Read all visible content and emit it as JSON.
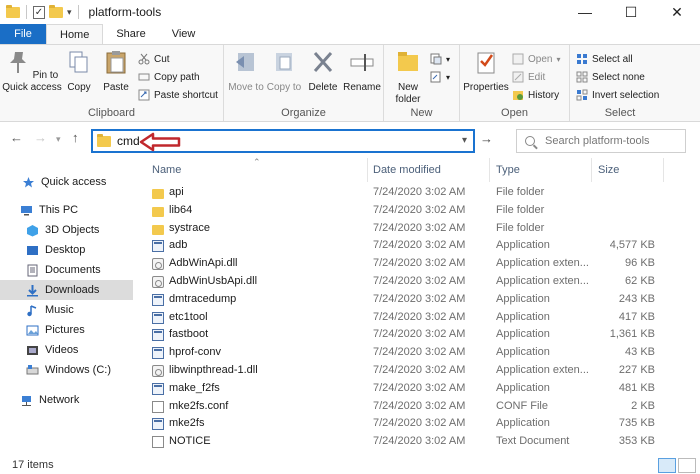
{
  "window": {
    "title": "platform-tools",
    "minimize": "—",
    "maximize": "☐",
    "close": "✕"
  },
  "tabs": [
    "File",
    "Home",
    "Share",
    "View"
  ],
  "ribbon": {
    "clipboard": {
      "label": "Clipboard",
      "pin": "Pin to Quick access",
      "copy": "Copy",
      "paste": "Paste",
      "cut": "Cut",
      "copy_path": "Copy path",
      "paste_shortcut": "Paste shortcut"
    },
    "organize": {
      "label": "Organize",
      "move_to": "Move to",
      "copy_to": "Copy to",
      "delete": "Delete",
      "rename": "Rename"
    },
    "new": {
      "label": "New",
      "new_folder": "New folder"
    },
    "open": {
      "label": "Open",
      "properties": "Properties",
      "open": "Open",
      "edit": "Edit",
      "history": "History"
    },
    "select": {
      "label": "Select",
      "select_all": "Select all",
      "select_none": "Select none",
      "invert": "Invert selection"
    }
  },
  "address": {
    "value": "cmd",
    "search_placeholder": "Search platform-tools"
  },
  "nav": [
    {
      "label": "Quick access",
      "icon": "star-icon",
      "selected": false
    },
    {
      "label": "This PC",
      "icon": "pc-icon",
      "selected": false
    },
    {
      "label": "3D Objects",
      "icon": "cube-icon",
      "selected": false
    },
    {
      "label": "Desktop",
      "icon": "desktop-icon",
      "selected": false
    },
    {
      "label": "Documents",
      "icon": "documents-icon",
      "selected": false
    },
    {
      "label": "Downloads",
      "icon": "download-icon",
      "selected": true
    },
    {
      "label": "Music",
      "icon": "music-icon",
      "selected": false
    },
    {
      "label": "Pictures",
      "icon": "pictures-icon",
      "selected": false
    },
    {
      "label": "Videos",
      "icon": "videos-icon",
      "selected": false
    },
    {
      "label": "Windows (C:)",
      "icon": "drive-icon",
      "selected": false
    },
    {
      "label": "Network",
      "icon": "network-icon",
      "selected": false
    }
  ],
  "columns": {
    "name": "Name",
    "date": "Date modified",
    "type": "Type",
    "size": "Size"
  },
  "files": [
    {
      "name": "api",
      "date": "7/24/2020 3:02 AM",
      "type": "File folder",
      "size": "",
      "icon": "folder"
    },
    {
      "name": "lib64",
      "date": "7/24/2020 3:02 AM",
      "type": "File folder",
      "size": "",
      "icon": "folder"
    },
    {
      "name": "systrace",
      "date": "7/24/2020 3:02 AM",
      "type": "File folder",
      "size": "",
      "icon": "folder"
    },
    {
      "name": "adb",
      "date": "7/24/2020 3:02 AM",
      "type": "Application",
      "size": "4,577 KB",
      "icon": "app"
    },
    {
      "name": "AdbWinApi.dll",
      "date": "7/24/2020 3:02 AM",
      "type": "Application exten...",
      "size": "96 KB",
      "icon": "dll"
    },
    {
      "name": "AdbWinUsbApi.dll",
      "date": "7/24/2020 3:02 AM",
      "type": "Application exten...",
      "size": "62 KB",
      "icon": "dll"
    },
    {
      "name": "dmtracedump",
      "date": "7/24/2020 3:02 AM",
      "type": "Application",
      "size": "243 KB",
      "icon": "app"
    },
    {
      "name": "etc1tool",
      "date": "7/24/2020 3:02 AM",
      "type": "Application",
      "size": "417 KB",
      "icon": "app"
    },
    {
      "name": "fastboot",
      "date": "7/24/2020 3:02 AM",
      "type": "Application",
      "size": "1,361 KB",
      "icon": "app"
    },
    {
      "name": "hprof-conv",
      "date": "7/24/2020 3:02 AM",
      "type": "Application",
      "size": "43 KB",
      "icon": "app"
    },
    {
      "name": "libwinpthread-1.dll",
      "date": "7/24/2020 3:02 AM",
      "type": "Application exten...",
      "size": "227 KB",
      "icon": "dll"
    },
    {
      "name": "make_f2fs",
      "date": "7/24/2020 3:02 AM",
      "type": "Application",
      "size": "481 KB",
      "icon": "app"
    },
    {
      "name": "mke2fs.conf",
      "date": "7/24/2020 3:02 AM",
      "type": "CONF File",
      "size": "2 KB",
      "icon": "doc"
    },
    {
      "name": "mke2fs",
      "date": "7/24/2020 3:02 AM",
      "type": "Application",
      "size": "735 KB",
      "icon": "app"
    },
    {
      "name": "NOTICE",
      "date": "7/24/2020 3:02 AM",
      "type": "Text Document",
      "size": "353 KB",
      "icon": "doc"
    }
  ],
  "status": {
    "count": "17 items"
  },
  "colors": {
    "accent": "#1a6ec6",
    "annotation_arrow": "#c0282d"
  }
}
